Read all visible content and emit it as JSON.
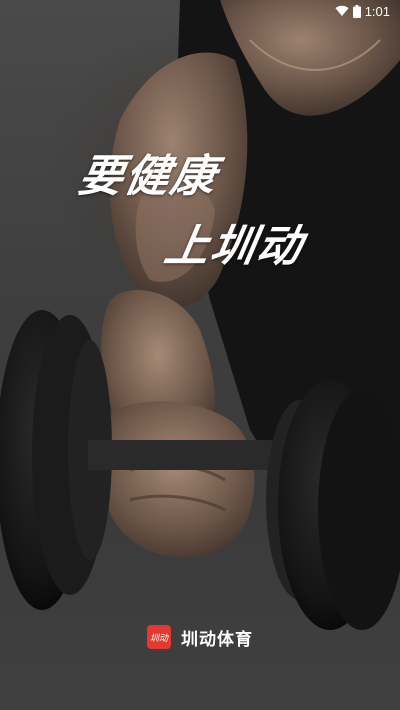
{
  "status_bar": {
    "time": "1:01",
    "wifi_icon": "wifi-icon",
    "battery_icon": "battery-icon"
  },
  "splash": {
    "slogan_line_1": "要健康",
    "slogan_line_2": "上圳动",
    "background_subject": "dumbbell-curl-photo"
  },
  "brand": {
    "logo_icon": "app-logo-icon",
    "logo_text": "圳动",
    "name": "圳动体育",
    "logo_color": "#e23a2e"
  }
}
